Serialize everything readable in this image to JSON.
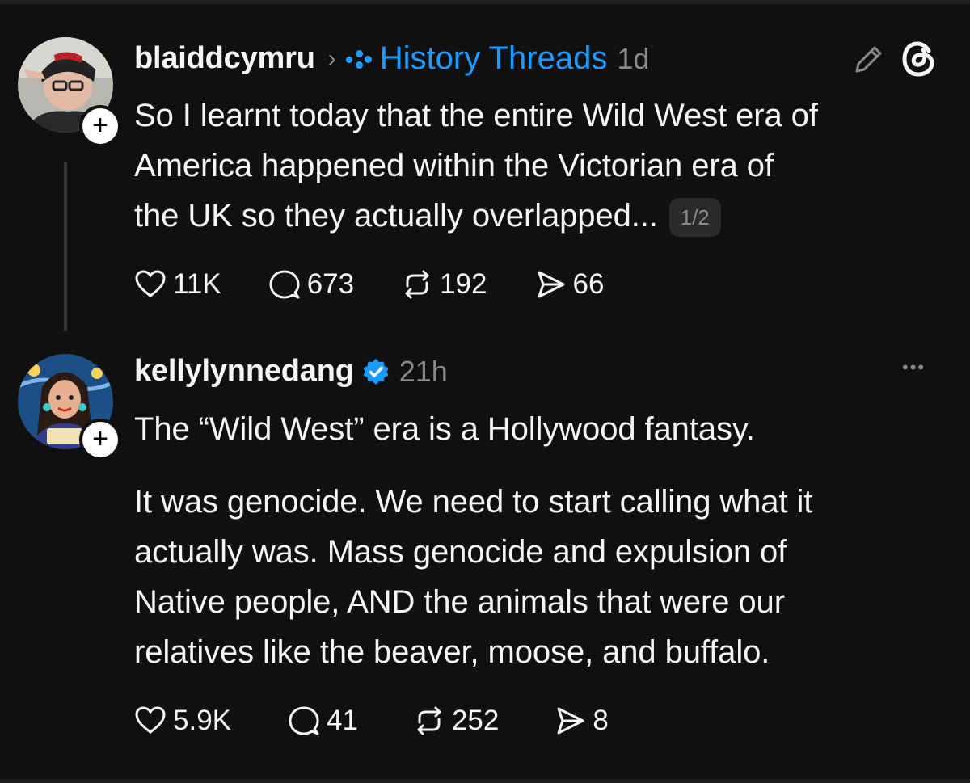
{
  "posts": [
    {
      "username": "blaiddcymru",
      "topic": "History Threads",
      "time": "1d",
      "text_lines": [
        "So I learnt today that the entire Wild West era of",
        "America happened within the Victorian era of",
        "the UK so they actually overlapped..."
      ],
      "page_badge": "1/2",
      "likes": "11K",
      "replies": "673",
      "reposts": "192",
      "shares": "66"
    },
    {
      "username": "kellylynnedang",
      "time": "21h",
      "text_lines": [
        "The “Wild West” era is a Hollywood fantasy.",
        "",
        "It was genocide. We need to start calling what it",
        "actually was. Mass genocide and expulsion of",
        "Native people, AND the animals that were our",
        "relatives like the beaver, moose, and buffalo."
      ],
      "likes": "5.9K",
      "replies": "41",
      "reposts": "252",
      "shares": "8"
    }
  ],
  "follow_label": "+",
  "more_label": "•••",
  "colors": {
    "background": "#101010",
    "text": "#f3f5f7",
    "muted": "#8a8a8a",
    "accent": "#1a9cff"
  },
  "icons": [
    "pencil-icon",
    "threads-logo-icon",
    "heart-icon",
    "comment-icon",
    "repost-icon",
    "share-icon",
    "verified-badge-icon",
    "more-icon",
    "chevron-right-icon"
  ]
}
